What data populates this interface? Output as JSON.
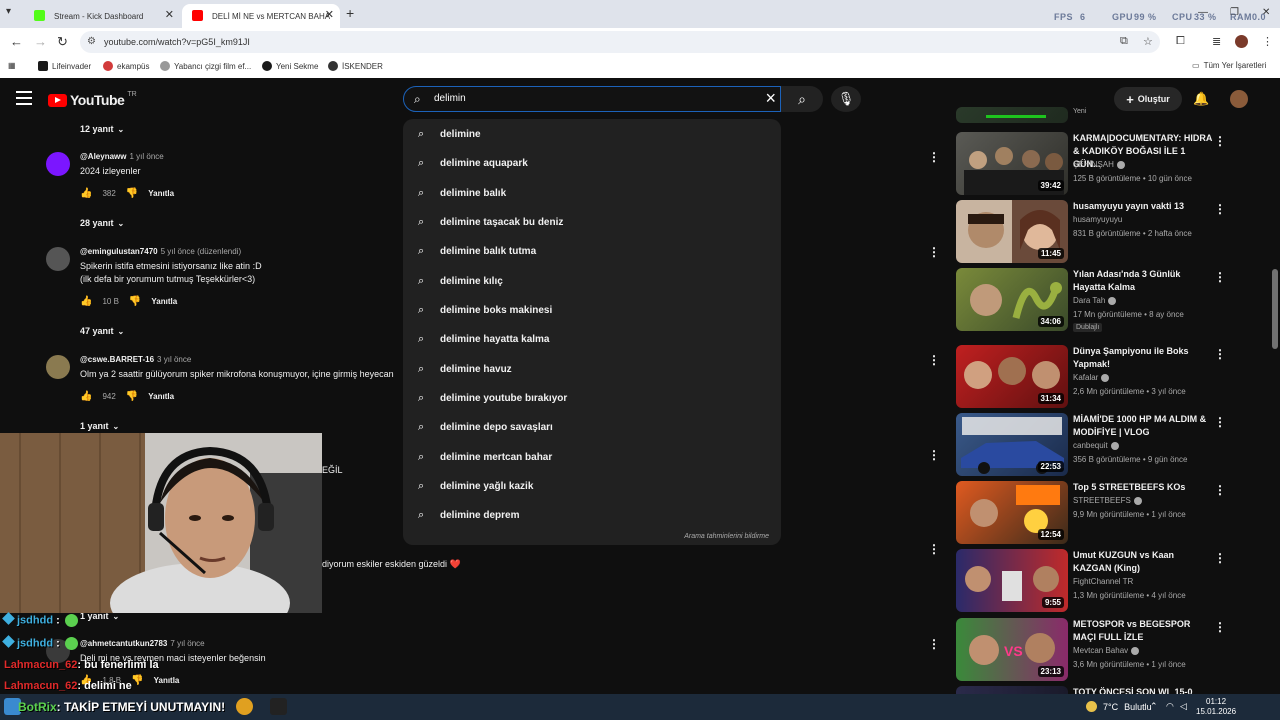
{
  "browser": {
    "tabs": [
      {
        "title": "Stream - Kick Dashboard",
        "favicon_color": "#53fc18"
      },
      {
        "title": "DELİ Mİ NE vs MERTCAN BAHA",
        "favicon_color": "#ff0000"
      }
    ],
    "hud": {
      "fps_label": "FPS",
      "fps_value": "6",
      "gpu_label": "GPU",
      "gpu_value": "99 %",
      "cpu_label": "CPU",
      "cpu_value": "33 %",
      "ram_label": "RAM",
      "ram_value": "0.0"
    },
    "url": "youtube.com/watch?v=pG5I_km91JI",
    "bookmarks": [
      {
        "label": "Lifeinvader",
        "color": "#1a1a1a"
      },
      {
        "label": "ekampüs",
        "color": "#d23b3b"
      },
      {
        "label": "Yabancı çizgi film ef...",
        "color": "#999999"
      },
      {
        "label": "Yeni Sekme",
        "color": "#1a1a1a"
      },
      {
        "label": "İSKENDER",
        "color": "#333333"
      }
    ],
    "all_bookmarks_label": "Tüm Yer İşaretleri"
  },
  "youtube": {
    "logo_text": "YouTube",
    "logo_region": "TR",
    "search_value": "delimin",
    "create_label": "Oluştur"
  },
  "suggestions": [
    "delimine",
    "delimine aquapark",
    "delimine balık",
    "delimine taşacak bu deniz",
    "delimine balık tutma",
    "delimine kılıç",
    "delimine boks makinesi",
    "delimine hayatta kalma",
    "delimine havuz",
    "delimine youtube bırakıyor",
    "delimine depo savaşları",
    "delimine mertcan bahar",
    "delimine yağlı kazik",
    "delimine deprem"
  ],
  "report_predictions": "Arama tahminlerini bildirme",
  "comments": [
    {
      "user": "@Aleynaww",
      "ago": "1 yıl önce",
      "text": "2024 izleyenler",
      "likes": "382",
      "reply": "Yanıtla",
      "avatar_color": "#7b16ff"
    },
    {
      "user": "@emingulustan7470",
      "ago": "5 yıl önce (düzenlendi)",
      "text": "Spikerin istifa etmesini istiyorsanız like atin :D\n(ilk defa bir yorumum tutmuş Teşekkürler<3)",
      "likes": "10 B",
      "reply": "Yanıtla",
      "avatar_color": "#555555"
    },
    {
      "user": "@cswe.BARRET-16",
      "ago": "3 yıl önce",
      "text": "Olm ya 2 saattir gülüyorum spiker mikrofona konuşmuyor, içine girmiş heyecan",
      "likes": "942",
      "reply": "Yanıtla",
      "avatar_color": "#8a7a50"
    },
    {
      "user": "@ahmetcantutkun2783",
      "ago": "7 yıl önce",
      "text": "Deli mi ne vs reymen maci isteyenler beğensin",
      "likes": "1,8 B",
      "reply": "Yanıtla",
      "avatar_color": "#3a3a3a"
    }
  ],
  "reply_counts": [
    "12 yanıt",
    "28 yanıt",
    "47 yanıt",
    "1 yanıt",
    "1 yanıt"
  ],
  "fragments": {
    "degil": "EĞİL",
    "eskiler": "diyorum eskiler eskiden güzeldi ❤️"
  },
  "chat": [
    {
      "user": "jsdhdd",
      "msg": "",
      "user_color": "blue"
    },
    {
      "user": "jsdhdd",
      "msg": "",
      "user_color": "blue"
    },
    {
      "user": "Lahmacun_62",
      "msg": ": bu fenerlimi la",
      "user_color": "red"
    },
    {
      "user": "Lahmacun_62",
      "msg": ": delimi ne",
      "user_color": "red"
    }
  ],
  "sidebar": [
    {
      "title": "Yeni",
      "channel": "",
      "views": "",
      "duration": "",
      "badge": "",
      "thumb_colors": [
        "#2a3a2a",
        "#1f2a1f"
      ]
    },
    {
      "title": "KARMA|DOCUMENTARY: HIDRA & KADIKÖY BOĞASI İLE 1 GÜN...",
      "channel": "ŞEHİNŞAH",
      "views": "125 B görüntüleme • 10 gün önce",
      "duration": "39:42",
      "badge": "",
      "thumb_colors": [
        "#5a5a55",
        "#2f2f2a"
      ]
    },
    {
      "title": "husamyuyu yayın vakti 13",
      "channel": "husamyuyuyu",
      "views": "831 B görüntüleme • 2 hafta önce",
      "duration": "11:45",
      "badge": "",
      "thumb_colors": [
        "#c8b4a0",
        "#6a4a3a"
      ]
    },
    {
      "title": "Yılan Adası'nda 3 Günlük Hayatta Kalma",
      "channel": "Dara Tah",
      "views": "17 Mn görüntüleme • 8 ay önce",
      "duration": "34:06",
      "badge": "Dublajlı",
      "thumb_colors": [
        "#7a8a3a",
        "#3a4a2a"
      ]
    },
    {
      "title": "Dünya Şampiyonu ile Boks Yapmak!",
      "channel": "Kafalar",
      "views": "2,6 Mn görüntüleme • 3 yıl önce",
      "duration": "31:34",
      "badge": "",
      "thumb_colors": [
        "#c02020",
        "#601010"
      ]
    },
    {
      "title": "MİAMİ'DE 1000 HP M4 ALDIM & MODİFİYE | VLOG",
      "channel": "canbequit",
      "views": "356 B görüntüleme • 9 gün önce",
      "duration": "22:53",
      "badge": "",
      "thumb_colors": [
        "#3a5a8a",
        "#1a2a4a"
      ]
    },
    {
      "title": "Top 5 STREETBEEFS KOs",
      "channel": "STREETBEEFS",
      "views": "9,9 Mn görüntüleme • 1 yıl önce",
      "duration": "12:54",
      "badge": "",
      "thumb_colors": [
        "#e05a20",
        "#3a2a1a"
      ]
    },
    {
      "title": "Umut KUZGUN vs Kaan KAZGAN (King)",
      "channel": "FightChannel TR",
      "views": "1,3 Mn görüntüleme • 4 yıl önce",
      "duration": "9:55",
      "badge": "",
      "thumb_colors": [
        "#2a2a6a",
        "#c02a2a"
      ]
    },
    {
      "title": "METOSPOR vs BEGESPOR MAÇI FULL İZLE",
      "channel": "Mevtcan Bahav",
      "views": "3,6 Mn görüntüleme • 1 yıl önce",
      "duration": "23:13",
      "badge": "",
      "thumb_colors": [
        "#3a8a3a",
        "#8a2a6a"
      ]
    },
    {
      "title": "TOTY ÖNCESİ SON WL 15-0",
      "channel": "",
      "views": "",
      "duration": "",
      "badge": "",
      "thumb_colors": [
        "#2a2a4a",
        "#1a1a2a"
      ]
    }
  ],
  "taskbar": {
    "ticker_user": "BotRix",
    "ticker_msg": ": TAKİP ETMEYİ UNUTMAYIN!",
    "temperature": "7°C",
    "weather": "Bulutlu",
    "time": "01:12",
    "date": "15.01.2026"
  }
}
